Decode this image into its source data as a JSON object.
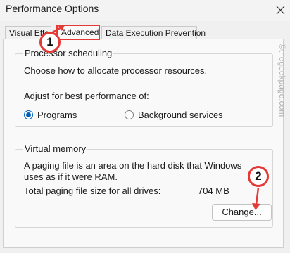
{
  "window": {
    "title": "Performance Options"
  },
  "tabs": [
    {
      "label": "Visual Effects",
      "active": false
    },
    {
      "label": "Advanced",
      "active": true
    },
    {
      "label": "Data Execution Prevention",
      "active": false
    }
  ],
  "processor": {
    "legend": "Processor scheduling",
    "description": "Choose how to allocate processor resources.",
    "adjust_label": "Adjust for best performance of:",
    "options": [
      {
        "label": "Programs",
        "selected": true
      },
      {
        "label": "Background services",
        "selected": false
      }
    ]
  },
  "virtual_memory": {
    "legend": "Virtual memory",
    "description": "A paging file is an area on the hard disk that Windows uses as if it were RAM.",
    "total_label": "Total paging file size for all drives:",
    "total_value": "704 MB",
    "change_label": "Change..."
  },
  "annotations": {
    "step1": "1",
    "step2": "2"
  },
  "watermark": "©thegeekpage.com",
  "colors": {
    "accent": "#005fb8",
    "callout": "#e53935"
  }
}
